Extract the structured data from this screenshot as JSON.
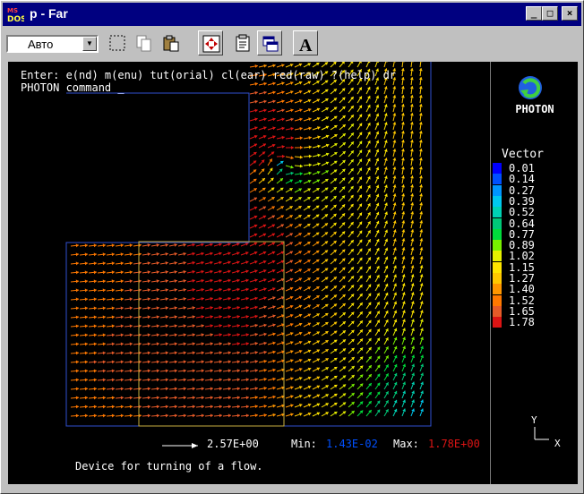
{
  "window": {
    "title": "p - Far",
    "app_icon": "ms-dos-icon",
    "controls": {
      "minimize": "_",
      "maximize": "□",
      "close": "×"
    }
  },
  "toolbar": {
    "font_size_combo": "Авто",
    "buttons": [
      "mark-icon",
      "copy-icon",
      "paste-icon",
      "fullscreen-icon",
      "properties-icon",
      "background-icon",
      "font-icon"
    ],
    "font_button_label": "A"
  },
  "console": {
    "line1": "Enter: e(nd) m(enu) tut(orial) cl(ear) red(raw) ?(help) dr",
    "line2": "PHOTON command _"
  },
  "logo": {
    "label": "PHOTON"
  },
  "legend": {
    "title": "Vector",
    "items": [
      {
        "value": "0.01",
        "color": "#0000ff"
      },
      {
        "value": "0.14",
        "color": "#0050ff"
      },
      {
        "value": "0.27",
        "color": "#0096ff"
      },
      {
        "value": "0.39",
        "color": "#00c8f0"
      },
      {
        "value": "0.52",
        "color": "#00d2b4"
      },
      {
        "value": "0.64",
        "color": "#00c878"
      },
      {
        "value": "0.77",
        "color": "#00dc3c"
      },
      {
        "value": "0.89",
        "color": "#78f000"
      },
      {
        "value": "1.02",
        "color": "#e6f000"
      },
      {
        "value": "1.15",
        "color": "#ffe600"
      },
      {
        "value": "1.27",
        "color": "#ffc800"
      },
      {
        "value": "1.40",
        "color": "#ff9600"
      },
      {
        "value": "1.52",
        "color": "#ff7800"
      },
      {
        "value": "1.65",
        "color": "#e65a28"
      },
      {
        "value": "1.78",
        "color": "#dc1414"
      }
    ]
  },
  "scale": {
    "ref_value": "2.57E+00",
    "min_label": "Min:",
    "min_value": "1.43E-02",
    "min_color": "#0050ff",
    "max_label": "Max:",
    "max_value": "1.78E+00",
    "max_color": "#dc1414"
  },
  "axes": {
    "x": "X",
    "y": "Y"
  },
  "caption": "Device for turning of a flow."
}
